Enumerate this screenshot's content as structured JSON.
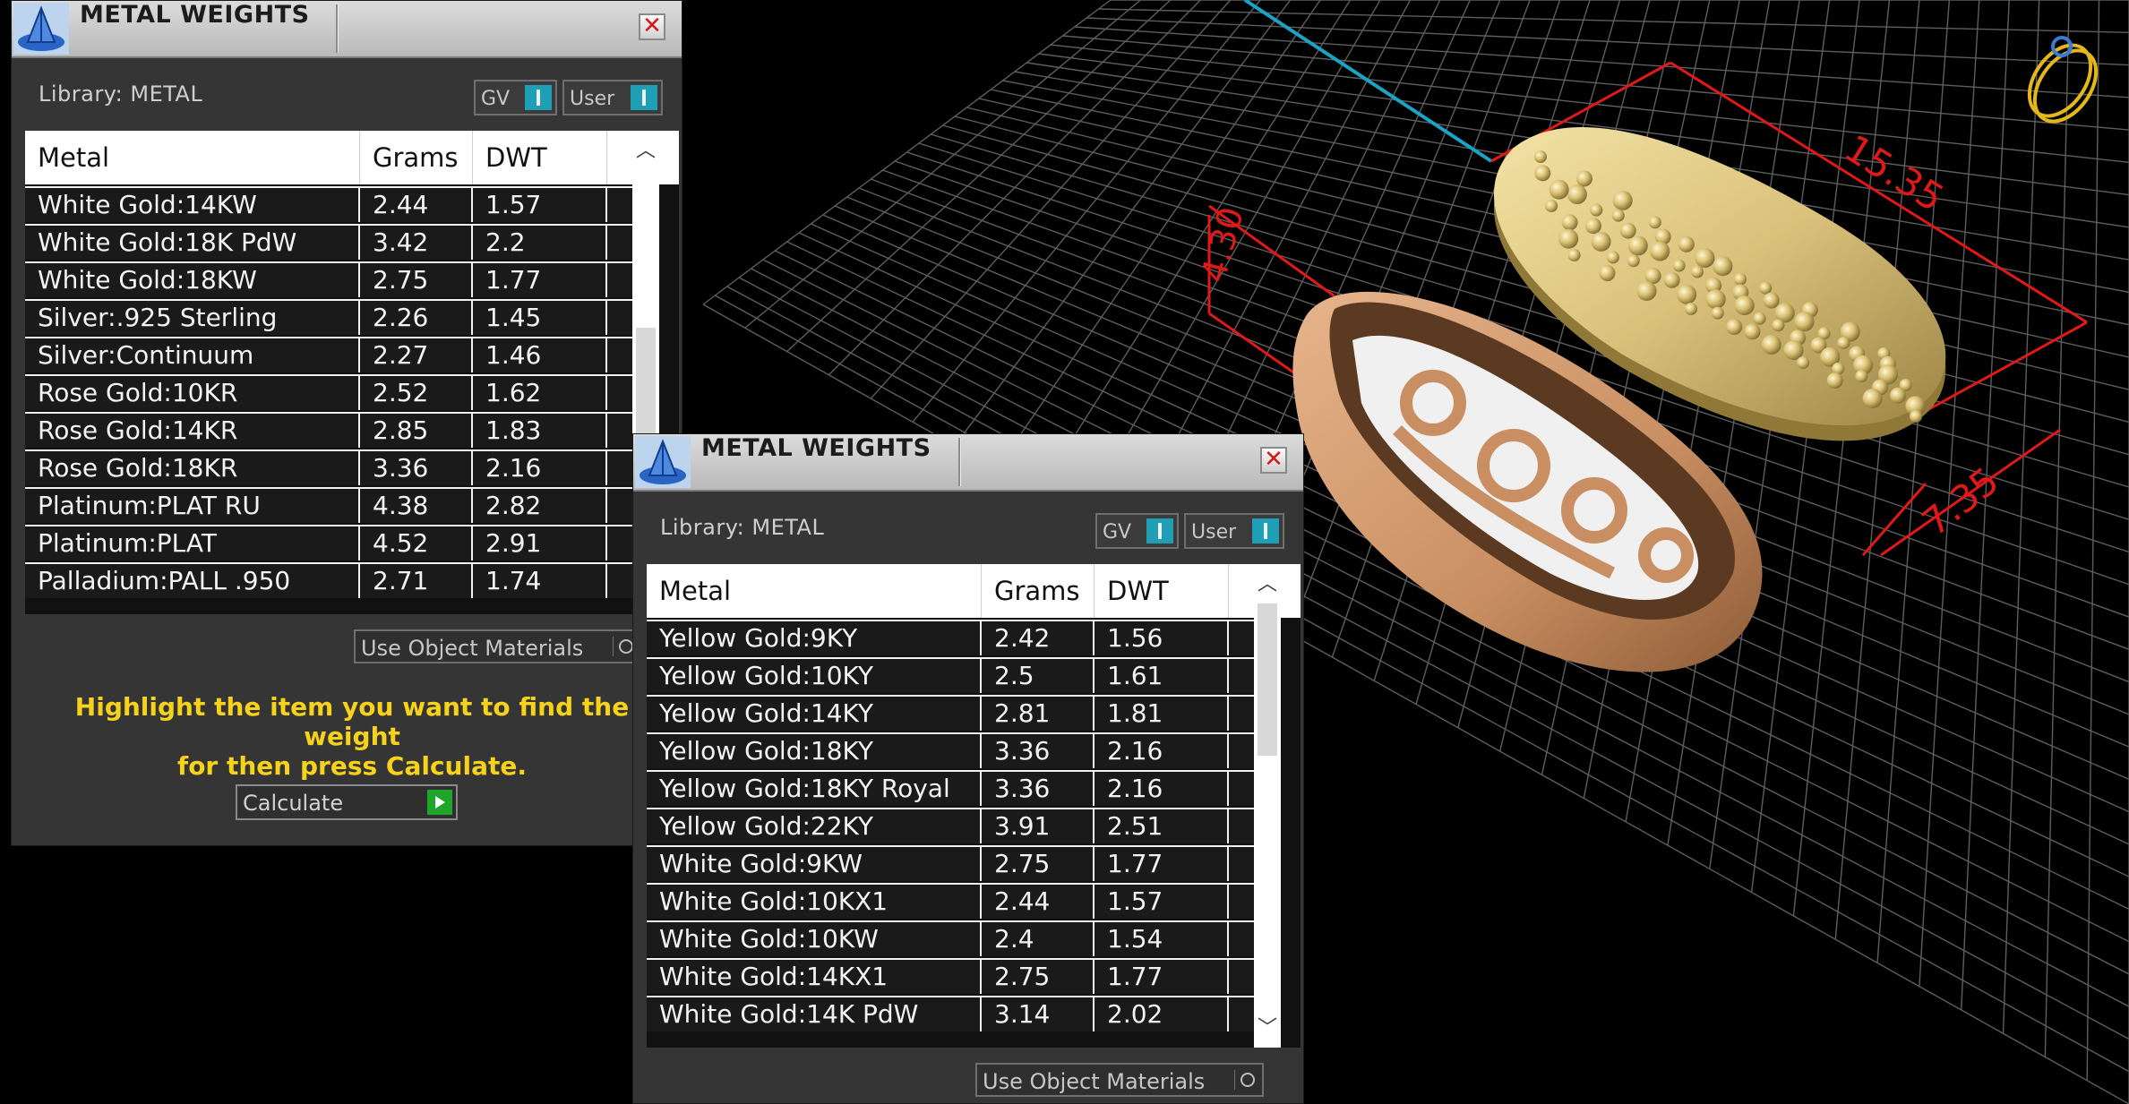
{
  "viewport": {
    "dimension_long": "15.35",
    "dimension_short": "7.35",
    "dimension_height": "4.30"
  },
  "window1": {
    "title": "METAL WEIGHTS",
    "close_glyph": "✕",
    "library_label": "Library: METAL",
    "toggle_gv": "GV",
    "toggle_user": "User",
    "columns": [
      "Metal",
      "Grams",
      "DWT"
    ],
    "rows": [
      [
        "White Gold:14KW",
        "2.44",
        "1.57"
      ],
      [
        "White Gold:18K PdW",
        "3.42",
        "2.2"
      ],
      [
        "White Gold:18KW",
        "2.75",
        "1.77"
      ],
      [
        "Silver:.925 Sterling",
        "2.26",
        "1.45"
      ],
      [
        "Silver:Continuum",
        "2.27",
        "1.46"
      ],
      [
        "Rose Gold:10KR",
        "2.52",
        "1.62"
      ],
      [
        "Rose Gold:14KR",
        "2.85",
        "1.83"
      ],
      [
        "Rose Gold:18KR",
        "3.36",
        "2.16"
      ],
      [
        "Platinum:PLAT RU",
        "4.38",
        "2.82"
      ],
      [
        "Platinum:PLAT",
        "4.52",
        "2.91"
      ],
      [
        "Palladium:PALL .950",
        "2.71",
        "1.74"
      ]
    ],
    "use_object_materials": "Use Object Materials",
    "hint_line1": "Highlight the item you want to find the weight",
    "hint_line2": "for then press Calculate.",
    "calculate": "Calculate"
  },
  "window2": {
    "title": "METAL WEIGHTS",
    "close_glyph": "✕",
    "library_label": "Library: METAL",
    "toggle_gv": "GV",
    "toggle_user": "User",
    "columns": [
      "Metal",
      "Grams",
      "DWT"
    ],
    "rows": [
      [
        "Yellow Gold:9KY",
        "2.42",
        "1.56"
      ],
      [
        "Yellow Gold:10KY",
        "2.5",
        "1.61"
      ],
      [
        "Yellow Gold:14KY",
        "2.81",
        "1.81"
      ],
      [
        "Yellow Gold:18KY",
        "3.36",
        "2.16"
      ],
      [
        "Yellow Gold:18KY Royal",
        "3.36",
        "2.16"
      ],
      [
        "Yellow Gold:22KY",
        "3.91",
        "2.51"
      ],
      [
        "White Gold:9KW",
        "2.75",
        "1.77"
      ],
      [
        "White Gold:10KX1",
        "2.44",
        "1.57"
      ],
      [
        "White Gold:10KW",
        "2.4",
        "1.54"
      ],
      [
        "White Gold:14KX1",
        "2.75",
        "1.77"
      ],
      [
        "White Gold:14K PdW",
        "3.14",
        "2.02"
      ]
    ],
    "use_object_materials": "Use Object Materials"
  }
}
